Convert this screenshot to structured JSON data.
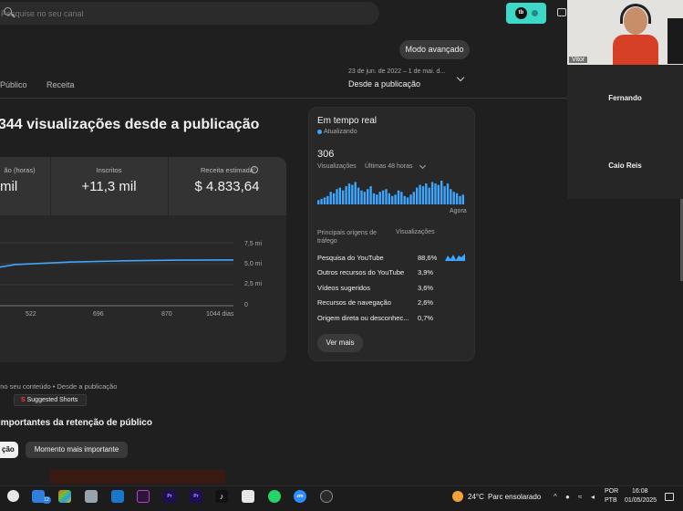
{
  "search": {
    "placeholder": "Pesquise no seu canal"
  },
  "header": {
    "advanced_mode": "Modo avançado"
  },
  "tabs": [
    "Público",
    "Receita"
  ],
  "date_range": {
    "range": "23 de jun. de 2022 – 1 de mai. d...",
    "label": "Desde a publicação"
  },
  "headline": "344 visualizações desde a publicação",
  "metrics": [
    {
      "title": "ão (horas)",
      "value": "mil"
    },
    {
      "title": "Inscritos",
      "value": "+11,3 mil"
    },
    {
      "title": "Receita estimada",
      "value": "$ 4.833,64"
    }
  ],
  "chart_data": {
    "type": "line",
    "x_ticks": [
      "522",
      "696",
      "870",
      "1044 dias"
    ],
    "y_ticks": [
      "7,5 mi",
      "5,0 mi",
      "2,5 mi",
      "0"
    ],
    "x": [
      300,
      348,
      522,
      696,
      870,
      1044
    ],
    "y": [
      4.6,
      4.9,
      5.2,
      5.35,
      5.42,
      5.45
    ],
    "ylim": [
      0,
      7.5
    ],
    "color": "#3ea6ff"
  },
  "realtime": {
    "title": "Em tempo real",
    "status": "Atualizando",
    "count": "306",
    "unit": "Visualizações",
    "period": "Últimas 48 horas",
    "now_label": "Agora",
    "bars": [
      3,
      4,
      5,
      6,
      9,
      8,
      11,
      12,
      10,
      13,
      15,
      14,
      16,
      12,
      10,
      9,
      11,
      13,
      8,
      7,
      9,
      10,
      11,
      8,
      6,
      7,
      10,
      9,
      6,
      5,
      7,
      9,
      12,
      14,
      13,
      15,
      12,
      16,
      15,
      14,
      17,
      13,
      15,
      11,
      9,
      8,
      6,
      7
    ],
    "sources_header_left": "Principais origens de tráfego",
    "sources_header_right": "Visualizações",
    "sources": [
      {
        "label": "Pesquisa do YouTube",
        "pct": "88,6%"
      },
      {
        "label": "Outros recursos do YouTube",
        "pct": "3,9%"
      },
      {
        "label": "Vídeos sugeridos",
        "pct": "3,6%"
      },
      {
        "label": "Recursos de navegação",
        "pct": "2,6%"
      },
      {
        "label": "Origem direta ou desconhec...",
        "pct": "0,7%"
      }
    ],
    "more_button": "Ver mais"
  },
  "content_line": "e no seu conteúdo • Desde a publicação",
  "shorts_chip": "Suggested Shorts",
  "retention_title": "importantes da retenção de público",
  "chips": [
    "ção",
    "Momento mais importante"
  ],
  "participants": {
    "webcam_name": "Vitor",
    "others": [
      "Fernando",
      "Caio Reis"
    ]
  },
  "taskbar": {
    "badge": "12",
    "weather_temp": "24°C",
    "weather_desc": "Parc ensolarado",
    "lang1": "POR",
    "lang2": "PTB",
    "time": "16:08",
    "date": "01/05/2025"
  }
}
